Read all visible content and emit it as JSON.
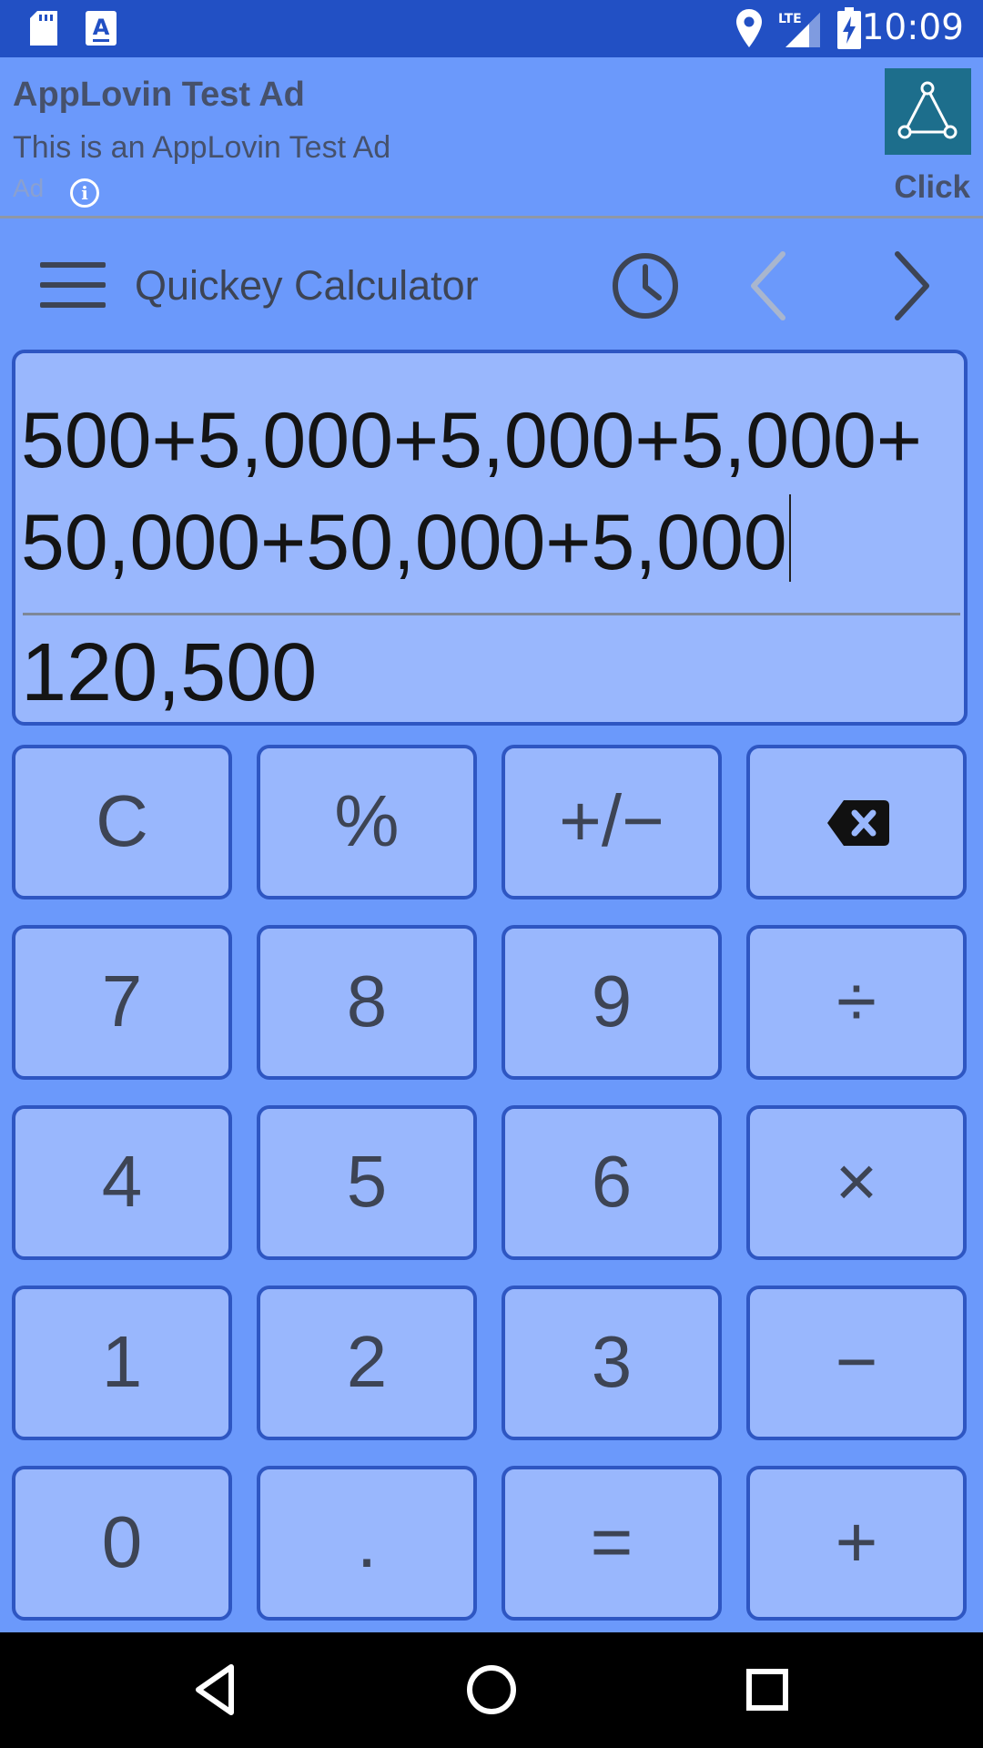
{
  "status_bar": {
    "time": "10:09",
    "network": "LTE",
    "icons": [
      "sd-card-icon",
      "keyboard-a-icon",
      "location-icon",
      "lte-signal-icon",
      "battery-charging-icon"
    ]
  },
  "ad": {
    "title": "AppLovin Test Ad",
    "subtitle": "This is an AppLovin Test Ad",
    "label": "Ad",
    "info_glyph": "i",
    "cta": "Click"
  },
  "toolbar": {
    "title": "Quickey Calculator",
    "icons": [
      "hamburger-menu-icon",
      "history-clock-icon",
      "chevron-left-icon",
      "chevron-right-icon"
    ]
  },
  "display": {
    "expression": "500+5,000+5,000+5,000+50,000+50,000+5,000",
    "result": "120,500"
  },
  "keys": [
    {
      "label": "C",
      "name": "clear"
    },
    {
      "label": "%",
      "name": "percent"
    },
    {
      "label": "+/−",
      "name": "sign"
    },
    {
      "label": "",
      "name": "backspace"
    },
    {
      "label": "7",
      "name": "7"
    },
    {
      "label": "8",
      "name": "8"
    },
    {
      "label": "9",
      "name": "9"
    },
    {
      "label": "÷",
      "name": "divide"
    },
    {
      "label": "4",
      "name": "4"
    },
    {
      "label": "5",
      "name": "5"
    },
    {
      "label": "6",
      "name": "6"
    },
    {
      "label": "×",
      "name": "multiply"
    },
    {
      "label": "1",
      "name": "1"
    },
    {
      "label": "2",
      "name": "2"
    },
    {
      "label": "3",
      "name": "3"
    },
    {
      "label": "−",
      "name": "minus"
    },
    {
      "label": "0",
      "name": "0"
    },
    {
      "label": ".",
      "name": "decimal"
    },
    {
      "label": "=",
      "name": "equals"
    },
    {
      "label": "+",
      "name": "plus"
    }
  ],
  "colors": {
    "status_bar": "#2250c4",
    "background": "#6b99fb",
    "key_fill": "#99b7fd",
    "key_border": "#2e56c2",
    "key_text": "#3d4454",
    "ad_logo": "#1d6e8c"
  }
}
